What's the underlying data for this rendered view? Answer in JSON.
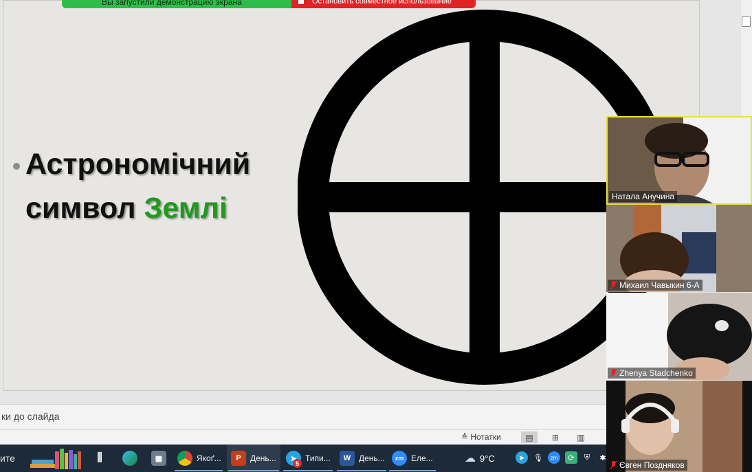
{
  "share_banner": {
    "status_text": "Вы запустили демонстрацию экрана",
    "stop_label": "Остановить совместное использование"
  },
  "slide": {
    "title_line1": "Астрономічний",
    "title_line2_prefix": "символ ",
    "title_line2_highlight": "Землі",
    "symbol_name": "earth-symbol",
    "highlight_color": "#1f9a1f"
  },
  "notes": {
    "placeholder": "ки до слайда"
  },
  "status_bar": {
    "notes_label": "Нотатки"
  },
  "taskbar": {
    "search_text": "ите",
    "apps": [
      {
        "icon": "books-icon",
        "label": ""
      },
      {
        "icon": "task-view-icon",
        "label": ""
      },
      {
        "icon": "edge-icon",
        "label": ""
      },
      {
        "icon": "calculator-icon",
        "label": ""
      },
      {
        "icon": "chrome-icon",
        "label": "Якоґ..."
      },
      {
        "icon": "powerpoint-icon",
        "label": "День..."
      },
      {
        "icon": "telegram-icon",
        "label": "Типи...",
        "badge": "5"
      },
      {
        "icon": "word-icon",
        "label": "День..."
      },
      {
        "icon": "zoom-icon",
        "label": "Еле..."
      }
    ],
    "weather": "9°C"
  },
  "participants": [
    {
      "name": "Натала Анучина",
      "muted": false,
      "speaking": true
    },
    {
      "name": "Михаил Чавыкин 6-А",
      "muted": true,
      "speaking": false
    },
    {
      "name": "Zhenya Stadchenko",
      "muted": true,
      "speaking": false
    },
    {
      "name": "Євген Поздняков",
      "muted": true,
      "speaking": false
    }
  ]
}
